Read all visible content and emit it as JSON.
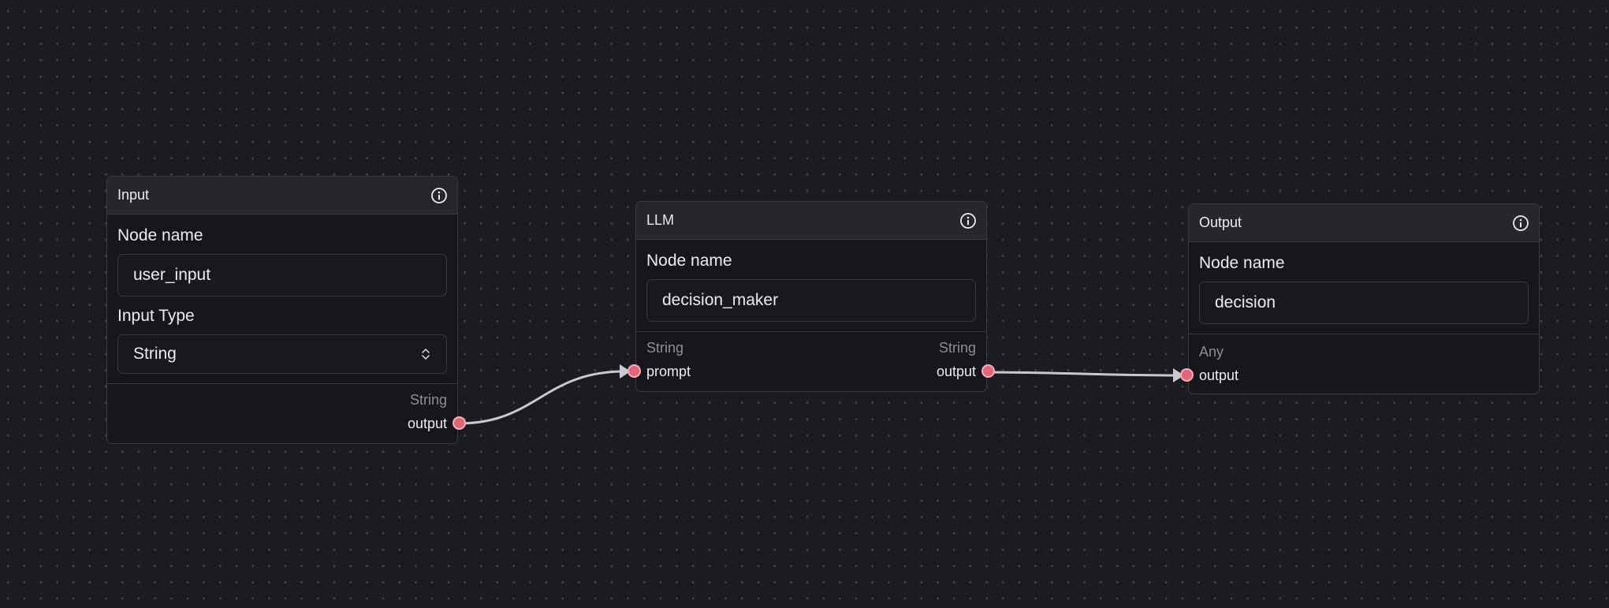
{
  "colors": {
    "canvas_bg": "#1c1b20",
    "node_bg": "#17161b",
    "header_bg": "#27262d",
    "border": "#3b3a42",
    "handle_fill": "#e0667a",
    "edge": "#c9c8ce"
  },
  "nodes": {
    "input": {
      "title": "Input",
      "info_icon": "info-icon",
      "name_label": "Node name",
      "name_value": "user_input",
      "type_label": "Input Type",
      "type_value": "String",
      "select_icon": "chevrons-up-down-icon",
      "output_type": "String",
      "output_port": "output"
    },
    "llm": {
      "title": "LLM",
      "info_icon": "info-icon",
      "name_label": "Node name",
      "name_value": "decision_maker",
      "input_type": "String",
      "input_port": "prompt",
      "output_type": "String",
      "output_port": "output"
    },
    "output": {
      "title": "Output",
      "info_icon": "info-icon",
      "name_label": "Node name",
      "name_value": "decision",
      "input_type": "Any",
      "input_port": "output"
    }
  }
}
